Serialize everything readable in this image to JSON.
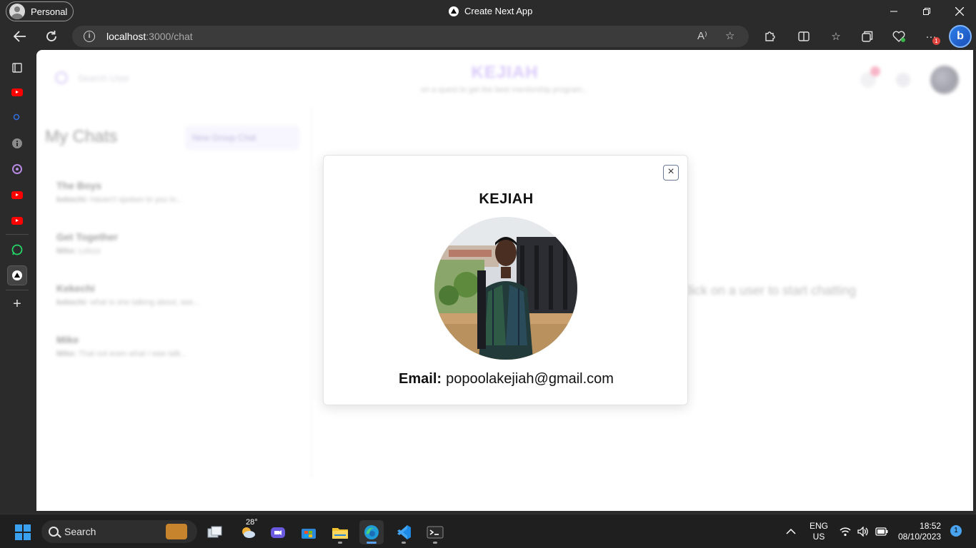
{
  "browser": {
    "profile_label": "Personal",
    "window_title": "Create Next App",
    "url_host": "localhost",
    "url_path": ":3000/chat",
    "extensions_badge": "1"
  },
  "app": {
    "brand": "KEJIAH",
    "tagline": "on a quest to get the best mentorship program...",
    "search_placeholder": "Search User",
    "my_chats_title": "My Chats",
    "new_group_label": "New Group Chat",
    "chats": [
      {
        "name": "The Boys",
        "preview_sender": "kekechi:",
        "preview_text": "Haven't spoken to you in..."
      },
      {
        "name": "Get Together",
        "preview_sender": "Mike:",
        "preview_text": "Lolzzz"
      },
      {
        "name": "Kekechi",
        "preview_sender": "kekechi:",
        "preview_text": "what is she talking about, see..."
      },
      {
        "name": "Mike",
        "preview_sender": "Mike:",
        "preview_text": "That not even what I was talk..."
      }
    ],
    "empty_state": "Click on a user to start chatting"
  },
  "modal": {
    "close_glyph": "×",
    "user_name": "KEJIAH",
    "email_label": "Email:",
    "email_value": "popoolakejiah@gmail.com"
  },
  "taskbar": {
    "search_label": "Search",
    "weather_temp": "28°",
    "lang_line1": "ENG",
    "lang_line2": "US",
    "time": "18:52",
    "date": "08/10/2023",
    "notification_count": "1"
  }
}
